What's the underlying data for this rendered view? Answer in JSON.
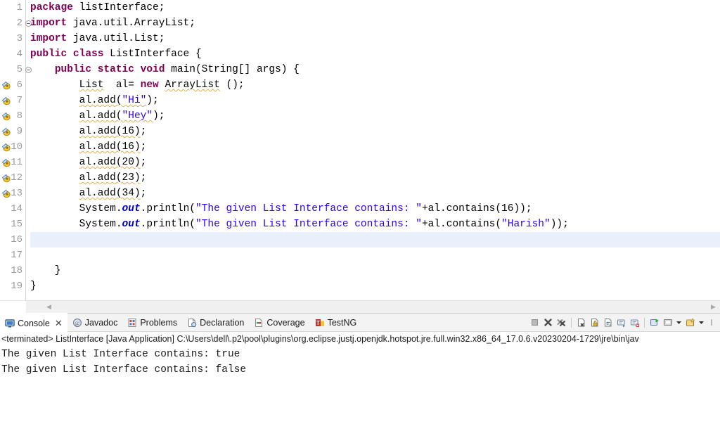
{
  "editor": {
    "lines": [
      {
        "n": "1",
        "fold": "none",
        "marker": "none",
        "changed": false,
        "current": false,
        "tokens": [
          {
            "t": "package ",
            "c": "kw"
          },
          {
            "t": "listInterface;",
            "c": "plain"
          }
        ]
      },
      {
        "n": "2",
        "fold": "collapse",
        "marker": "none",
        "changed": false,
        "current": false,
        "tokens": [
          {
            "t": "import ",
            "c": "kw"
          },
          {
            "t": "java.util.ArrayList;",
            "c": "plain"
          }
        ]
      },
      {
        "n": "3",
        "fold": "none",
        "marker": "none",
        "changed": false,
        "current": false,
        "tokens": [
          {
            "t": "import ",
            "c": "kw"
          },
          {
            "t": "java.util.List;",
            "c": "plain"
          }
        ]
      },
      {
        "n": "4",
        "fold": "none",
        "marker": "none",
        "changed": false,
        "current": false,
        "tokens": [
          {
            "t": "public class ",
            "c": "kw"
          },
          {
            "t": "ListInterface {",
            "c": "plain"
          }
        ]
      },
      {
        "n": "5",
        "fold": "collapse",
        "marker": "none",
        "changed": true,
        "current": false,
        "tokens": [
          {
            "t": "    ",
            "c": "plain"
          },
          {
            "t": "public static void ",
            "c": "kw"
          },
          {
            "t": "main(String[] args) {",
            "c": "plain"
          }
        ]
      },
      {
        "n": "6",
        "fold": "none",
        "marker": "warning",
        "changed": true,
        "current": false,
        "tokens": [
          {
            "t": "        ",
            "c": "plain"
          },
          {
            "t": "List",
            "c": "plain sq"
          },
          {
            "t": "  al= ",
            "c": "plain"
          },
          {
            "t": "new ",
            "c": "kw"
          },
          {
            "t": "ArrayList",
            "c": "plain sq"
          },
          {
            "t": " ();",
            "c": "plain"
          }
        ]
      },
      {
        "n": "7",
        "fold": "none",
        "marker": "warning",
        "changed": true,
        "current": false,
        "tokens": [
          {
            "t": "        ",
            "c": "plain"
          },
          {
            "t": "al.add(",
            "c": "plain sq"
          },
          {
            "t": "\"Hi\"",
            "c": "str sq"
          },
          {
            "t": ");",
            "c": "plain"
          }
        ]
      },
      {
        "n": "8",
        "fold": "none",
        "marker": "warning",
        "changed": true,
        "current": false,
        "tokens": [
          {
            "t": "        ",
            "c": "plain"
          },
          {
            "t": "al.add(",
            "c": "plain sq"
          },
          {
            "t": "\"Hey\"",
            "c": "str sq"
          },
          {
            "t": ");",
            "c": "plain"
          }
        ]
      },
      {
        "n": "9",
        "fold": "none",
        "marker": "warning",
        "changed": true,
        "current": false,
        "tokens": [
          {
            "t": "        ",
            "c": "plain"
          },
          {
            "t": "al.add(16)",
            "c": "plain sq"
          },
          {
            "t": ";",
            "c": "plain"
          }
        ]
      },
      {
        "n": "10",
        "fold": "none",
        "marker": "warning",
        "changed": true,
        "current": false,
        "tokens": [
          {
            "t": "        ",
            "c": "plain"
          },
          {
            "t": "al.add(16)",
            "c": "plain sq"
          },
          {
            "t": ";",
            "c": "plain"
          }
        ]
      },
      {
        "n": "11",
        "fold": "none",
        "marker": "warning",
        "changed": true,
        "current": false,
        "tokens": [
          {
            "t": "        ",
            "c": "plain"
          },
          {
            "t": "al.add(20)",
            "c": "plain sq"
          },
          {
            "t": ";",
            "c": "plain"
          }
        ]
      },
      {
        "n": "12",
        "fold": "none",
        "marker": "warning",
        "changed": true,
        "current": false,
        "tokens": [
          {
            "t": "        ",
            "c": "plain"
          },
          {
            "t": "al.add(23)",
            "c": "plain sq"
          },
          {
            "t": ";",
            "c": "plain"
          }
        ]
      },
      {
        "n": "13",
        "fold": "none",
        "marker": "warning",
        "changed": true,
        "current": false,
        "tokens": [
          {
            "t": "        ",
            "c": "plain"
          },
          {
            "t": "al.add(34)",
            "c": "plain sq"
          },
          {
            "t": ";",
            "c": "plain"
          }
        ]
      },
      {
        "n": "14",
        "fold": "none",
        "marker": "none",
        "changed": true,
        "current": false,
        "tokens": [
          {
            "t": "        ",
            "c": "plain"
          },
          {
            "t": "System.",
            "c": "plain"
          },
          {
            "t": "out",
            "c": "fld"
          },
          {
            "t": ".println(",
            "c": "plain"
          },
          {
            "t": "\"The given List Interface contains: \"",
            "c": "str"
          },
          {
            "t": "+al.contains(16));",
            "c": "plain"
          }
        ]
      },
      {
        "n": "15",
        "fold": "none",
        "marker": "none",
        "changed": true,
        "current": false,
        "tokens": [
          {
            "t": "        ",
            "c": "plain"
          },
          {
            "t": "System.",
            "c": "plain"
          },
          {
            "t": "out",
            "c": "fld"
          },
          {
            "t": ".println(",
            "c": "plain"
          },
          {
            "t": "\"The given List Interface contains: \"",
            "c": "str"
          },
          {
            "t": "+al.contains(",
            "c": "plain"
          },
          {
            "t": "\"Harish\"",
            "c": "str"
          },
          {
            "t": "));",
            "c": "plain"
          }
        ]
      },
      {
        "n": "16",
        "fold": "none",
        "marker": "none",
        "changed": true,
        "current": true,
        "tokens": [
          {
            "t": "        ",
            "c": "plain"
          }
        ]
      },
      {
        "n": "17",
        "fold": "none",
        "marker": "none",
        "changed": true,
        "current": false,
        "tokens": [
          {
            "t": "",
            "c": "plain"
          }
        ]
      },
      {
        "n": "18",
        "fold": "none",
        "marker": "none",
        "changed": true,
        "current": false,
        "tokens": [
          {
            "t": "    }",
            "c": "plain"
          }
        ]
      },
      {
        "n": "19",
        "fold": "none",
        "marker": "none",
        "changed": false,
        "current": false,
        "tokens": [
          {
            "t": "}",
            "c": "plain"
          }
        ]
      }
    ],
    "scrollbar": {
      "left_arrow": "◀",
      "right_arrow": "▶"
    }
  },
  "panel": {
    "tabs": [
      {
        "label": "Console",
        "icon": "console-icon",
        "active": true,
        "closable": true,
        "close": "✕"
      },
      {
        "label": "Javadoc",
        "icon": "javadoc-icon",
        "active": false,
        "closable": false,
        "close": ""
      },
      {
        "label": "Problems",
        "icon": "problems-icon",
        "active": false,
        "closable": false,
        "close": ""
      },
      {
        "label": "Declaration",
        "icon": "declaration-icon",
        "active": false,
        "closable": false,
        "close": ""
      },
      {
        "label": "Coverage",
        "icon": "coverage-icon",
        "active": false,
        "closable": false,
        "close": ""
      },
      {
        "label": "TestNG",
        "icon": "testng-icon",
        "active": false,
        "closable": false,
        "close": ""
      }
    ],
    "toolbar": [
      {
        "name": "terminate-button",
        "kind": "stop"
      },
      {
        "name": "terminate-all-button",
        "kind": "x-bold"
      },
      {
        "name": "remove-all-terminated-button",
        "kind": "x-multi"
      },
      {
        "name": "separator-1",
        "kind": "sep"
      },
      {
        "name": "clear-console-button",
        "kind": "clear"
      },
      {
        "name": "scroll-lock-button",
        "kind": "lock"
      },
      {
        "name": "word-wrap-button",
        "kind": "wrap"
      },
      {
        "name": "show-console-on-output-button",
        "kind": "show-out"
      },
      {
        "name": "show-console-on-error-button",
        "kind": "show-err"
      },
      {
        "name": "separator-2",
        "kind": "sep"
      },
      {
        "name": "pin-console-button",
        "kind": "pin"
      },
      {
        "name": "display-selected-console-button",
        "kind": "display"
      },
      {
        "name": "display-console-dropdown",
        "kind": "caret"
      },
      {
        "name": "open-console-button",
        "kind": "new-console"
      },
      {
        "name": "open-console-dropdown",
        "kind": "caret"
      },
      {
        "name": "view-menu-button",
        "kind": "edge"
      }
    ],
    "console": {
      "header": "<terminated> ListInterface [Java Application] C:\\Users\\dell\\.p2\\pool\\plugins\\org.eclipse.justj.openjdk.hotspot.jre.full.win32.x86_64_17.0.6.v20230204-1729\\jre\\bin\\jav",
      "output": [
        "The given List Interface contains: true",
        "The given List Interface contains: false"
      ]
    }
  },
  "colors": {
    "keyword": "#7f0055",
    "string": "#2a00ff",
    "static_field": "#0000c0",
    "line_number": "#9a9a9a",
    "current_line_bg": "#e8f0fc",
    "change_bar": "#62a3e0",
    "warning_squiggle": "#e6b422",
    "panel_bg": "#f3f3f3"
  }
}
